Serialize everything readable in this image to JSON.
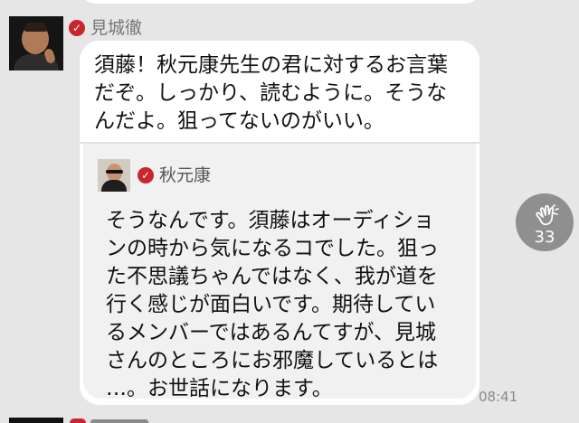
{
  "message": {
    "sender": "見城徹",
    "text": "須藤！秋元康先生の君に対するお言葉\nだぞ。しっかり、読むように。そうな\nんだよ。狙ってないのがいい。",
    "time": "08:41"
  },
  "quoted_post": {
    "sender": "秋元康",
    "text": "そうなんです。須藤はオーディショ\nンの時から気になるコでした。狙っ\nた不思議ちゃんではなく、我が道を\n行く感じが面白いです。期待してい\nるメンバーではあるんてすが、見城\nさんのところにお邪魔しているとは\n…。お世話になります。"
  },
  "reaction": {
    "icon": "clap-icon",
    "count": "33"
  },
  "icons": {
    "verified": "verified-check-icon",
    "sender_avatar": "profile-photo",
    "quoted_avatar": "profile-photo"
  },
  "colors": {
    "background": "#e6e6e6",
    "bubble": "#ffffff",
    "quote_card": "#f1f1f1",
    "verified": "#c9252b",
    "reaction_button": "#8f8f8f"
  }
}
